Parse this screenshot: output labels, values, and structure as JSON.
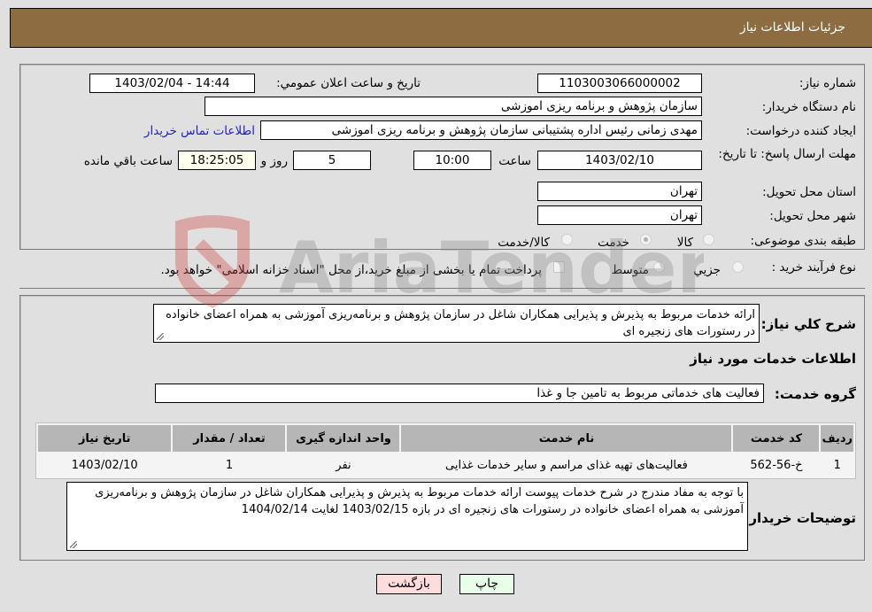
{
  "header": {
    "title": "جزئیات اطلاعات نیاز"
  },
  "fields": {
    "need_number_label": "شماره نیاز:",
    "need_number": "1103003066000002",
    "announce_label": "تاریخ و ساعت اعلان عمومي:",
    "announce_value": "1403/02/04 - 14:44",
    "buyer_org_label": "نام دستگاه خریدار:",
    "buyer_org": "سازمان پژوهش و برنامه ریزی اموزشی",
    "creator_label": "ایجاد کننده درخواست:",
    "creator": "مهدی زمانی رئیس اداره پشتیبانی سازمان پژوهش و برنامه ریزی اموزشی",
    "contact_link": "اطلاعات تماس خریدار",
    "deadline_label": "مهلت ارسال پاسخ: تا تاریخ:",
    "deadline_date": "1403/02/10",
    "time_label": "ساعت",
    "deadline_time": "10:00",
    "days_value": "5",
    "days_label": "روز و",
    "remaining_time": "18:25:05",
    "remaining_label": "ساعت باقي مانده",
    "province_label": "استان محل تحویل:",
    "province": "تهران",
    "city_label": "شهر محل تحویل:",
    "city": "تهران",
    "category_label": "طبقه بندی موضوعی:",
    "category_options": [
      "کالا",
      "خدمت",
      "کالا/خدمت"
    ],
    "category_selected": "خدمت",
    "process_label": "نوع فرآیند خرید :",
    "process_options": [
      "جزيي",
      "متوسط"
    ],
    "treasury_note": "پرداخت تمام یا بخشی از مبلغ خرید،از محل \"اسناد خزانه اسلامی\" خواهد بود."
  },
  "description": {
    "label": "شرح کلي نیاز:",
    "text": "ارائه خدمات مربوط به پذیرش و پذیرایی همکاران شاغل در سازمان پژوهش و برنامه‌ریزی آموزشی به همراه اعضای خانواده در رستورات های زنجیره ای"
  },
  "services": {
    "section_title": "اطلاعات خدمات مورد نیاز",
    "group_label": "گروه خدمت:",
    "group_value": "فعالیت های خدماتی مربوط به تامین جا و غذا",
    "columns": [
      "ردیف",
      "کد خدمت",
      "نام خدمت",
      "واحد اندازه گیری",
      "تعداد / مقدار",
      "تاریخ نیاز"
    ],
    "rows": [
      [
        "1",
        "خ-56-562",
        "فعالیت‌های تهیه غذای مراسم و سایر خدمات غذایی",
        "نفر",
        "1",
        "1403/02/10"
      ]
    ]
  },
  "buyer_notes": {
    "label": "توضیحات خریدار:",
    "text": "با توجه به مفاد مندرج در شرح خدمات پیوست ارائه خدمات مربوط به پذیرش و پذیرایی همکاران شاغل در سازمان پژوهش و برنامه‌ریزی آموزشی به همراه اعضای خانواده در رستورات های زنجیره ای در بازه 1403/02/15 لغایت 1404/02/14"
  },
  "buttons": {
    "back": "بازگشت",
    "print": "چاپ"
  },
  "watermark": "AriaTender.neT",
  "colors": {
    "header_bg": "#8e6c42",
    "link": "#2020d0",
    "back_btn": "#fddcdc",
    "print_btn": "#e8ffe8",
    "remaining_bg": "#ffffee"
  }
}
